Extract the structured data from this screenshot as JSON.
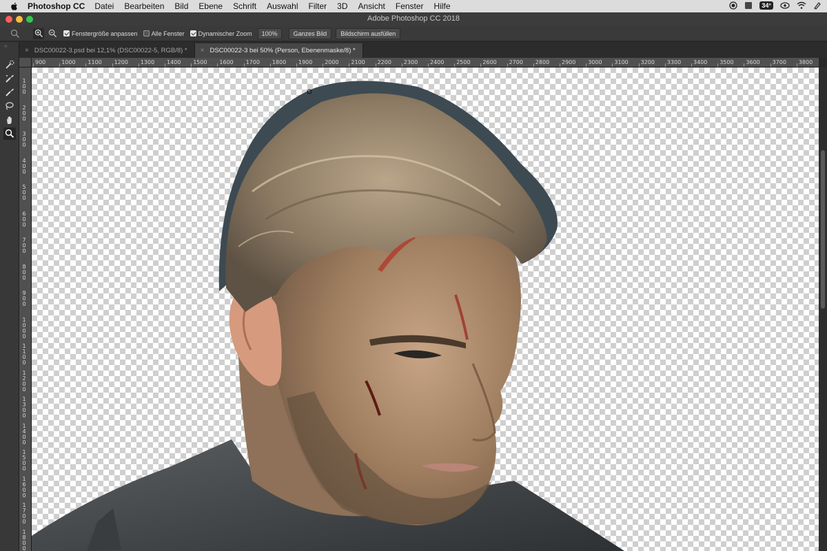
{
  "menubar": {
    "app_name": "Photoshop CC",
    "items": [
      "Datei",
      "Bearbeiten",
      "Bild",
      "Ebene",
      "Schrift",
      "Auswahl",
      "Filter",
      "3D",
      "Ansicht",
      "Fenster",
      "Hilfe"
    ],
    "tray_badge": "34°"
  },
  "window": {
    "title": "Adobe Photoshop CC 2018",
    "traffic_colors": [
      "#fc605c",
      "#fdbc40",
      "#34c84a"
    ]
  },
  "optionsbar": {
    "fit_window_label": "Fenstergröße anpassen",
    "fit_window_checked": true,
    "all_windows_label": "Alle Fenster",
    "all_windows_checked": false,
    "scrubby_zoom_label": "Dynamischer Zoom",
    "scrubby_zoom_checked": true,
    "zoom_value": "100%",
    "fit_screen_label": "Ganzes Bild",
    "fill_screen_label": "Bildschirm ausfüllen"
  },
  "tabs": [
    {
      "label": "DSC00022-3.psd bei 12,1% (DSC00022-5, RGB/8) *",
      "active": false
    },
    {
      "label": "DSC00022-3 bei 50% (Person, Ebenenmaske/8) *",
      "active": true
    }
  ],
  "rulers": {
    "top_labels": [
      "900",
      "1000",
      "1100",
      "1200",
      "1300",
      "1400",
      "1500",
      "1600",
      "1700",
      "1800",
      "1900",
      "2000",
      "2100",
      "2200",
      "2300",
      "2400",
      "2500",
      "2600",
      "2700",
      "2800",
      "2900",
      "3000",
      "3100",
      "3200",
      "3300",
      "3400",
      "3500",
      "3600",
      "3700",
      "3800"
    ],
    "left_labels": [
      "100",
      "200",
      "300",
      "400",
      "500",
      "600",
      "700",
      "800",
      "900",
      "1000",
      "1100",
      "1200",
      "1300",
      "1400",
      "1500",
      "1600",
      "1700",
      "1800"
    ]
  },
  "tools": [
    "quick-selection-brush-icon",
    "refine-edge-brush-icon",
    "brush-icon",
    "lasso-icon",
    "hand-icon",
    "zoom-icon"
  ],
  "canvas": {
    "mask_overlay_color": "#3d4a52"
  }
}
